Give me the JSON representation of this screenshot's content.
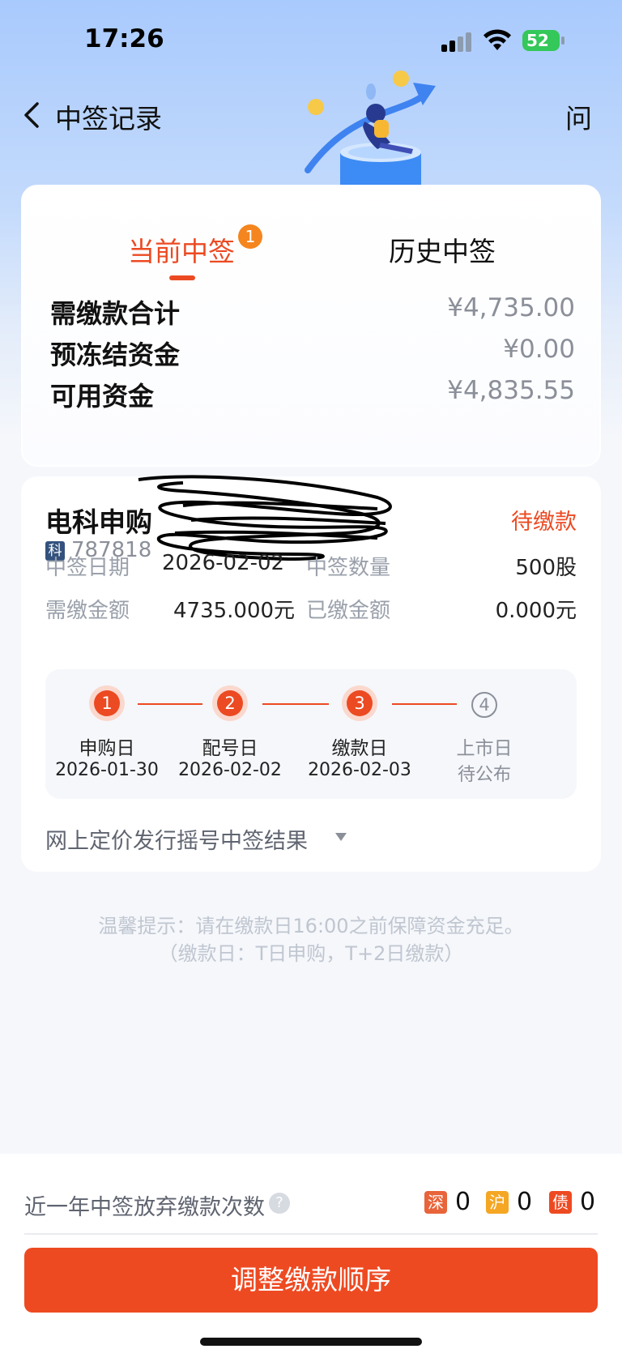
{
  "status_bar": {
    "time": "17:26",
    "battery": "52"
  },
  "nav": {
    "title": "中签记录",
    "help_label": "问"
  },
  "tabs": [
    {
      "label": "当前中签",
      "badge": "1",
      "active": true
    },
    {
      "label": "历史中签",
      "active": false
    }
  ],
  "summary": [
    {
      "label": "需缴款合计",
      "value": "¥4,735.00"
    },
    {
      "label": "预冻结资金",
      "value": "¥0.00"
    },
    {
      "label": "可用资金",
      "value": "¥4,835.55"
    }
  ],
  "stock": {
    "name": "电科申购",
    "status": "待缴款",
    "market_tag": "科",
    "code": "787818",
    "info": [
      {
        "label": "中签日期",
        "value": "2026-02-02"
      },
      {
        "label": "中签数量",
        "value": "500股"
      },
      {
        "label": "需缴金额",
        "value": "4735.000元"
      },
      {
        "label": "已缴金额",
        "value": "0.000元"
      }
    ],
    "steps": [
      {
        "num": "1",
        "name": "申购日",
        "date": "2026-01-30",
        "done": true
      },
      {
        "num": "2",
        "name": "配号日",
        "date": "2026-02-02",
        "done": true
      },
      {
        "num": "3",
        "name": "缴款日",
        "date": "2026-02-03",
        "done": true
      },
      {
        "num": "④",
        "name": "上市日",
        "date": "待公布",
        "done": false
      }
    ],
    "result_label": "网上定价发行摇号中签结果"
  },
  "tip": {
    "line1": "温馨提示：请在缴款日16:00之前保障资金充足。",
    "line2": "（缴款日：T日申购，T+2日缴款）"
  },
  "abandon": {
    "label": "近一年中签放弃缴款次数",
    "help_icon": "?",
    "markets": [
      {
        "tag": "深",
        "count": "0",
        "color": "#e8643a"
      },
      {
        "tag": "沪",
        "count": "0",
        "color": "#f5a623"
      },
      {
        "tag": "债",
        "count": "0",
        "color": "#ee4a22"
      }
    ]
  },
  "button": {
    "label": "调整缴款顺序"
  },
  "colors": {
    "accent": "#ec4a22",
    "button": "#ee4a22",
    "tag_blue": "#33527e"
  }
}
